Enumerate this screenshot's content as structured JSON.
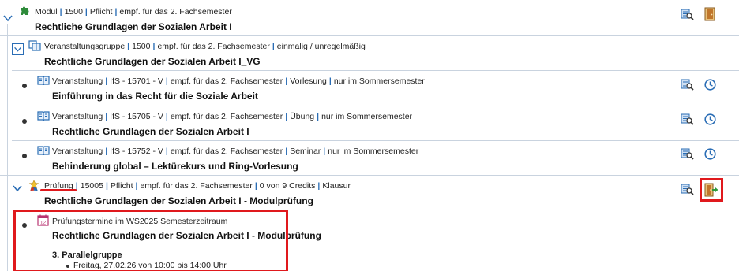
{
  "rows": [
    {
      "meta": [
        "Modul",
        "1500",
        "Pflicht",
        "empf. für das 2. Fachsemester"
      ],
      "title": "Rechtliche Grundlagen der Sozialen Arbeit I"
    },
    {
      "meta": [
        "Veranstaltungsgruppe",
        "1500",
        "empf. für das 2. Fachsemester",
        "einmalig / unregelmäßig"
      ],
      "title": "Rechtliche Grundlagen der Sozialen Arbeit I_VG"
    },
    {
      "meta": [
        "Veranstaltung",
        "IfS - 15701 - V",
        "empf. für das 2. Fachsemester",
        "Vorlesung",
        "nur im Sommersemester"
      ],
      "title": "Einführung in das Recht für die Soziale Arbeit"
    },
    {
      "meta": [
        "Veranstaltung",
        "IfS - 15705 - V",
        "empf. für das 2. Fachsemester",
        "Übung",
        "nur im Sommersemester"
      ],
      "title": "Rechtliche Grundlagen der Sozialen Arbeit I"
    },
    {
      "meta": [
        "Veranstaltung",
        "IfS - 15752 - V",
        "empf. für das 2. Fachsemester",
        "Seminar",
        "nur im Sommersemester"
      ],
      "title": "Behinderung global – Lektürekurs und Ring-Vorlesung"
    },
    {
      "meta": [
        "Prüfung",
        "15005",
        "Pflicht",
        "empf. für das 2. Fachsemester",
        "0 von 9 Credits",
        "Klausur"
      ],
      "title": "Rechtliche Grundlagen der Sozialen Arbeit I - Modulprüfung"
    }
  ],
  "exam_dates": {
    "header": "Prüfungstermine im WS2025 Semesterzeitraum",
    "title": "Rechtliche Grundlagen der Sozialen Arbeit I - Modulprüfung",
    "group": "3. Parallelgruppe",
    "date": "Freitag, 27.02.26 von 10:00 bis 14:00 Uhr",
    "calendar_day": "12"
  },
  "colors": {
    "accent": "#2a6db5",
    "highlight": "#e0191d",
    "module_icon": "#2e8b3a"
  },
  "icons": {
    "module": "puzzle-icon",
    "group": "group-book-icon",
    "course": "book-icon",
    "exam": "award-icon",
    "details": "magnifier-details-icon",
    "clock": "clock-icon",
    "door": "door-icon",
    "register": "register-door-icon",
    "calendar": "calendar-icon"
  }
}
